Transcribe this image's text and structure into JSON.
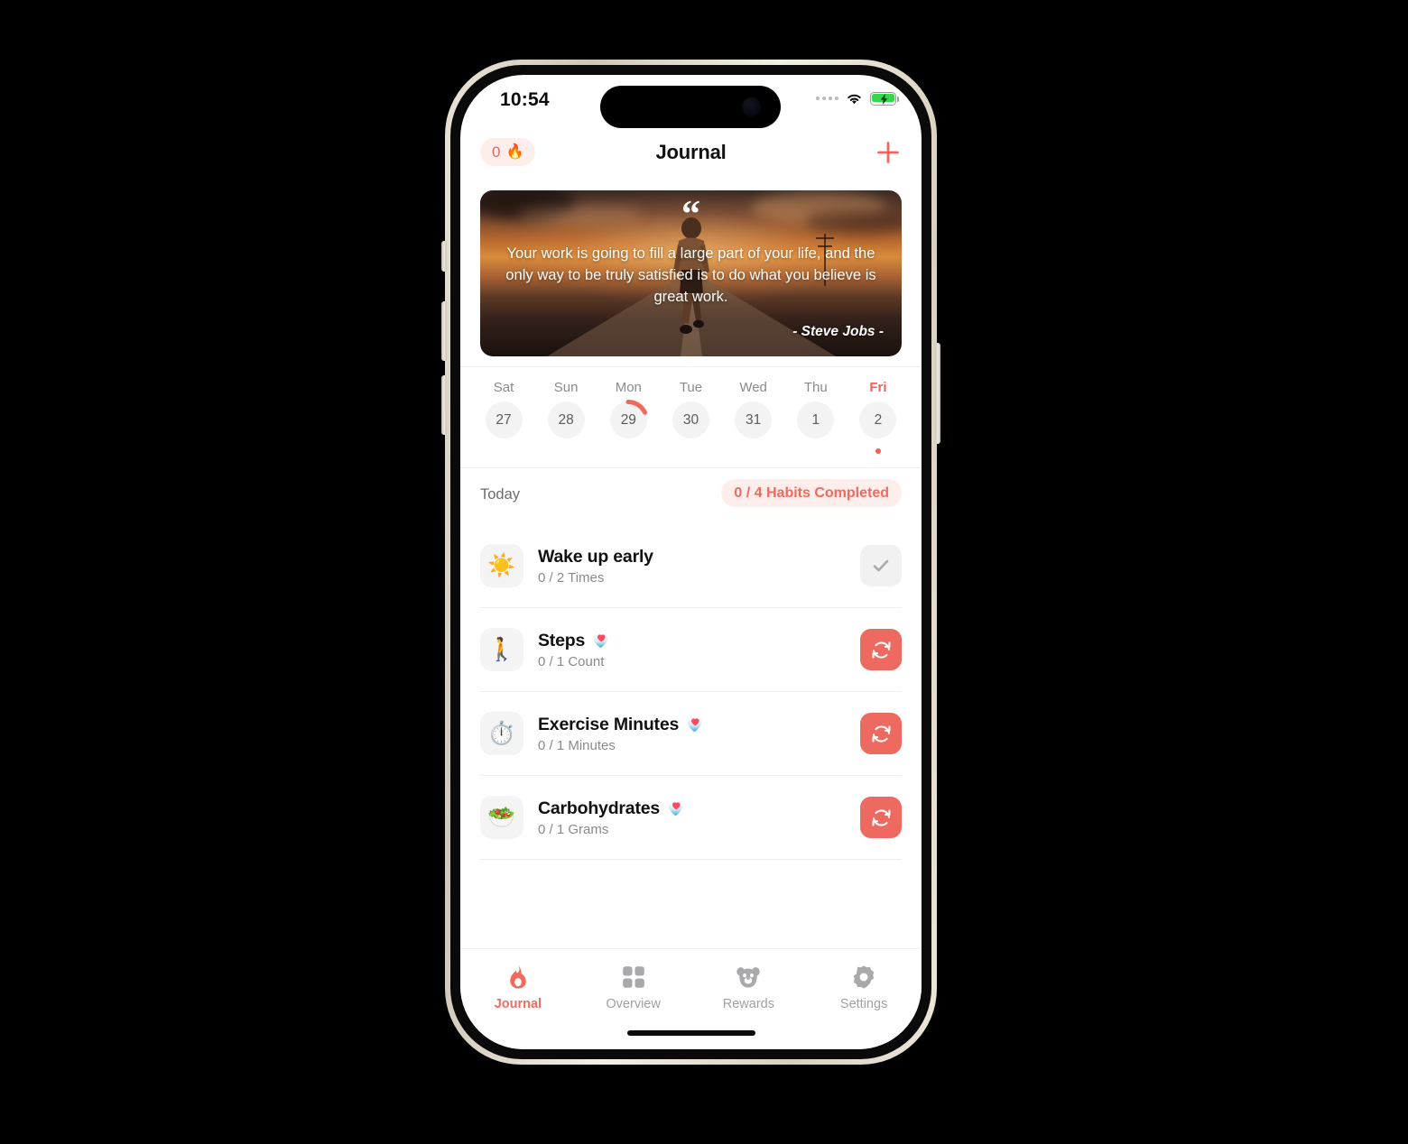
{
  "status_bar": {
    "time": "10:54",
    "signal_icon": "cellular-dots-icon",
    "wifi_icon": "wifi-icon",
    "battery_icon": "battery-charging-icon",
    "battery_color": "#32d74b"
  },
  "nav_bar": {
    "streak_count": "0",
    "streak_icon": "flame-emoji",
    "title": "Journal",
    "add_icon": "plus-icon",
    "accent_color": "#f1655b"
  },
  "quote_card": {
    "quote_mark": "“",
    "text": "Your work is going to fill a large part of your life, and the only way to be truly satisfied is to do what you believe is great work.",
    "author": "- Steve Jobs -"
  },
  "week_strip": {
    "days": [
      {
        "name": "Sat",
        "date": "27",
        "selected": false,
        "progress": 0,
        "has_dot": false
      },
      {
        "name": "Sun",
        "date": "28",
        "selected": false,
        "progress": 0,
        "has_dot": false
      },
      {
        "name": "Mon",
        "date": "29",
        "selected": false,
        "progress": 18,
        "has_dot": false
      },
      {
        "name": "Tue",
        "date": "30",
        "selected": false,
        "progress": 0,
        "has_dot": false
      },
      {
        "name": "Wed",
        "date": "31",
        "selected": false,
        "progress": 0,
        "has_dot": false
      },
      {
        "name": "Thu",
        "date": "1",
        "selected": false,
        "progress": 0,
        "has_dot": false
      },
      {
        "name": "Fri",
        "date": "2",
        "selected": true,
        "progress": 0,
        "has_dot": true
      }
    ]
  },
  "today_section": {
    "label": "Today",
    "habits_badge": "0 / 4 Habits Completed"
  },
  "habits": [
    {
      "emoji": "☀️",
      "emoji_name": "sun-emoji",
      "title": "Wake up early",
      "progress": "0 / 2 Times",
      "health_linked": false,
      "action": "check",
      "action_icon": "checkmark-icon"
    },
    {
      "emoji": "🚶",
      "emoji_name": "walking-person-emoji",
      "title": "Steps",
      "progress": "0 / 1 Count",
      "health_linked": true,
      "action": "sync",
      "action_icon": "refresh-sync-icon"
    },
    {
      "emoji": "⏱️",
      "emoji_name": "stopwatch-emoji",
      "title": "Exercise Minutes",
      "progress": "0 / 1 Minutes",
      "health_linked": true,
      "action": "sync",
      "action_icon": "refresh-sync-icon"
    },
    {
      "emoji": "🥗",
      "emoji_name": "salad-emoji",
      "title": "Carbohydrates",
      "progress": "0 / 1 Grams",
      "health_linked": true,
      "action": "sync",
      "action_icon": "refresh-sync-icon"
    }
  ],
  "tab_bar": {
    "items": [
      {
        "label": "Journal",
        "icon": "flame-icon",
        "active": true
      },
      {
        "label": "Overview",
        "icon": "grid-squares-icon",
        "active": false
      },
      {
        "label": "Rewards",
        "icon": "bear-face-icon",
        "active": false
      },
      {
        "label": "Settings",
        "icon": "gear-icon",
        "active": false
      }
    ]
  }
}
